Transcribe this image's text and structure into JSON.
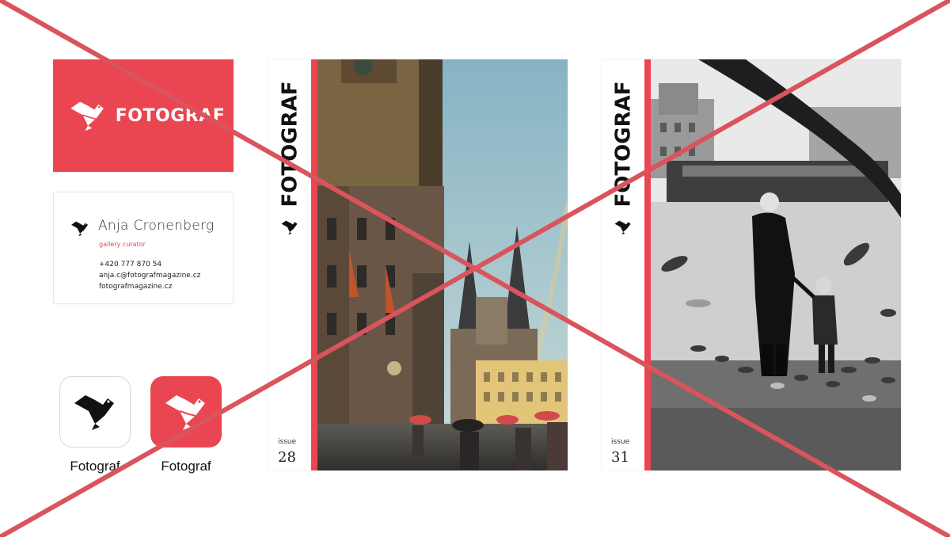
{
  "colors": {
    "accent": "#e94651",
    "cross": "#d9545c",
    "bird_dark": "#111111",
    "white": "#ffffff"
  },
  "brand": {
    "wordmark": "FOTOGRAF",
    "logo_icon": "bird-logo-icon"
  },
  "business_card": {
    "name": "Anja Cronenberg",
    "role": "gallery curator",
    "phone": "+420 777 870 54",
    "email": "anja.c@fotografmagazine.cz",
    "website": "fotografmagazine.cz"
  },
  "app_icons": [
    {
      "label": "Fotograf",
      "style": "light"
    },
    {
      "label": "Fotograf",
      "style": "red"
    }
  ],
  "covers": [
    {
      "title": "FOTOGRAF",
      "issue_label": "issue",
      "issue_number": "28"
    },
    {
      "title": "FOTOGRAF",
      "issue_label": "issue",
      "issue_number": "31"
    }
  ]
}
